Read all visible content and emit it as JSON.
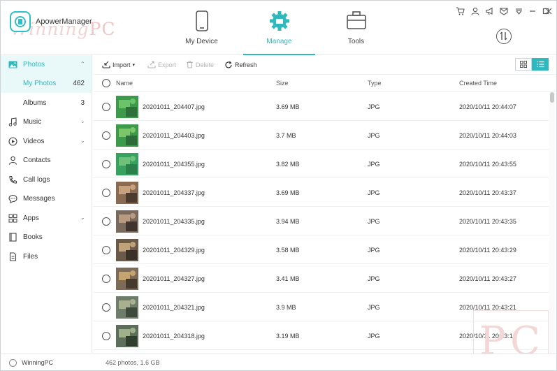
{
  "app": {
    "name": "ApowerManager",
    "watermark": "WinningPC"
  },
  "colors": {
    "accent": "#2fb9bf",
    "accent_light": "#e9f8f8",
    "text": "#333333"
  },
  "nav": {
    "tabs": [
      {
        "label": "My Device",
        "icon": "phone-icon",
        "active": false
      },
      {
        "label": "Manage",
        "icon": "gear-icon",
        "active": true
      },
      {
        "label": "Tools",
        "icon": "toolbox-icon",
        "active": false
      }
    ]
  },
  "window_controls": [
    "cart-icon",
    "user-icon",
    "megaphone-icon",
    "mail-icon",
    "dropdown-icon",
    "minimize-icon",
    "maximize-icon",
    "close-icon"
  ],
  "sidebar": {
    "items": [
      {
        "label": "Photos",
        "icon": "image-icon",
        "chevron": "^"
      },
      {
        "label": "My Photos",
        "count": "462"
      },
      {
        "label": "Albums",
        "count": "3"
      },
      {
        "label": "Music",
        "icon": "music-icon",
        "chevron": "v"
      },
      {
        "label": "Videos",
        "icon": "play-icon",
        "chevron": "v"
      },
      {
        "label": "Contacts",
        "icon": "person-icon"
      },
      {
        "label": "Call logs",
        "icon": "phone-call-icon"
      },
      {
        "label": "Messages",
        "icon": "chat-icon"
      },
      {
        "label": "Apps",
        "icon": "apps-grid-icon",
        "chevron": "v"
      },
      {
        "label": "Books",
        "icon": "book-icon"
      },
      {
        "label": "Files",
        "icon": "file-icon"
      }
    ]
  },
  "toolbar": {
    "import_label": "Import",
    "export_label": "Export",
    "delete_label": "Delete",
    "refresh_label": "Refresh"
  },
  "table": {
    "columns": [
      "Name",
      "Size",
      "Type",
      "Created Time"
    ],
    "rows": [
      {
        "name": "20201011_204407.jpg",
        "size": "3.69 MB",
        "type": "JPG",
        "created": "2020/10/11 20:44:07"
      },
      {
        "name": "20201011_204403.jpg",
        "size": "3.7 MB",
        "type": "JPG",
        "created": "2020/10/11 20:44:03"
      },
      {
        "name": "20201011_204355.jpg",
        "size": "3.82 MB",
        "type": "JPG",
        "created": "2020/10/11 20:43:55"
      },
      {
        "name": "20201011_204337.jpg",
        "size": "3.69 MB",
        "type": "JPG",
        "created": "2020/10/11 20:43:37"
      },
      {
        "name": "20201011_204335.jpg",
        "size": "3.94 MB",
        "type": "JPG",
        "created": "2020/10/11 20:43:35"
      },
      {
        "name": "20201011_204329.jpg",
        "size": "3.58 MB",
        "type": "JPG",
        "created": "2020/10/11 20:43:29"
      },
      {
        "name": "20201011_204327.jpg",
        "size": "3.41 MB",
        "type": "JPG",
        "created": "2020/10/11 20:43:27"
      },
      {
        "name": "20201011_204321.jpg",
        "size": "3.9 MB",
        "type": "JPG",
        "created": "2020/10/11 20:43:21"
      },
      {
        "name": "20201011_204318.jpg",
        "size": "3.19 MB",
        "type": "JPG",
        "created": "2020/10/11 20:43:18"
      }
    ]
  },
  "status": {
    "user": "WinningPC",
    "summary": "462 photos, 1.6 GB"
  }
}
